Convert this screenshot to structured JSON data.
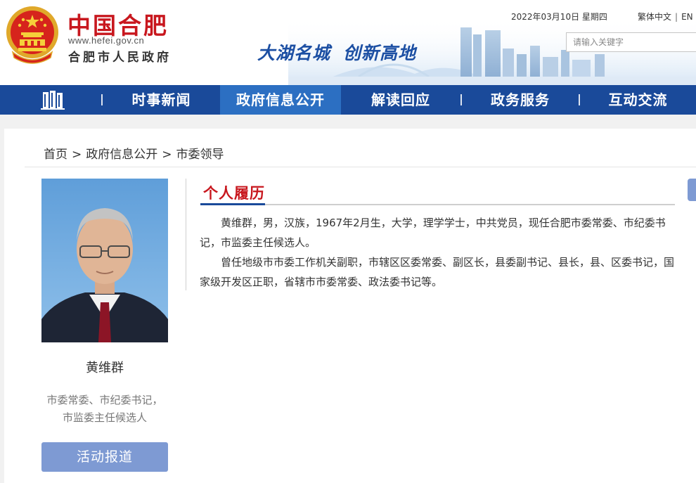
{
  "header": {
    "site_title": "中国合肥",
    "site_url": "www.hefei.gov.cn",
    "site_org": "合肥市人民政府",
    "slogan_part1": "大湖名城",
    "slogan_part2": "创新高地",
    "date": "2022年03月10日 星期四",
    "lang_traditional": "繁体中文",
    "lang_english": "EN",
    "search_placeholder": "请输入关键字"
  },
  "nav": {
    "items": [
      {
        "label": "时事新闻",
        "active": false
      },
      {
        "label": "政府信息公开",
        "active": true
      },
      {
        "label": "解读回应",
        "active": false
      },
      {
        "label": "政务服务",
        "active": false
      },
      {
        "label": "互动交流",
        "active": false
      }
    ]
  },
  "breadcrumb": {
    "items": [
      "首页",
      "政府信息公开",
      "市委领导"
    ],
    "separator": ">"
  },
  "profile": {
    "name": "黄维群",
    "title_line1": "市委常委、市纪委书记，",
    "title_line2": "市监委主任候选人",
    "report_button": "活动报道"
  },
  "bio": {
    "heading": "个人履历",
    "paragraph1": "黄维群，男，汉族，1967年2月生，大学，理学学士，中共党员，现任合肥市委常委、市纪委书记，市监委主任候选人。",
    "paragraph2": "曾任地级市市委工作机关副职，市辖区区委常委、副区长，县委副书记、县长，县、区委书记，国家级开发区正职，省辖市市委常委、政法委书记等。"
  },
  "colors": {
    "brand_red": "#c8171e",
    "nav_blue": "#1a4a9a",
    "nav_active": "#2c6fc2",
    "button_blue": "#7e9ad3"
  },
  "icons": {
    "emblem": "national-emblem-icon",
    "home": "home-building-icon"
  }
}
